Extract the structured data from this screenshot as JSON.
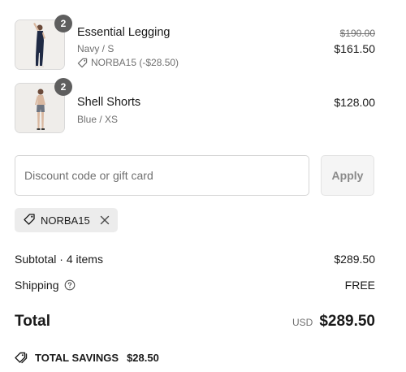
{
  "items": [
    {
      "name": "Essential Legging",
      "variant": "Navy / S",
      "quantity": "2",
      "discount_code": "NORBA15 (-$28.50)",
      "original_price": "$190.00",
      "price": "$161.50",
      "image_icon": "product-photo-legging"
    },
    {
      "name": "Shell Shorts",
      "variant": "Blue / XS",
      "quantity": "2",
      "price": "$128.00",
      "image_icon": "product-photo-shorts"
    }
  ],
  "discount": {
    "placeholder": "Discount code or gift card",
    "apply_label": "Apply",
    "applied_code": "NORBA15"
  },
  "summary": {
    "subtotal_label": "Subtotal · 4 items",
    "subtotal_value": "$289.50",
    "shipping_label": "Shipping",
    "shipping_value": "FREE",
    "total_label": "Total",
    "currency": "USD",
    "total_value": "$289.50",
    "savings_label": "TOTAL SAVINGS",
    "savings_value": "$28.50"
  },
  "colors": {
    "badge": "#5e5e5e",
    "chip_bg": "#ececec",
    "apply_bg": "#f5f5f5",
    "muted_text": "#707070"
  }
}
